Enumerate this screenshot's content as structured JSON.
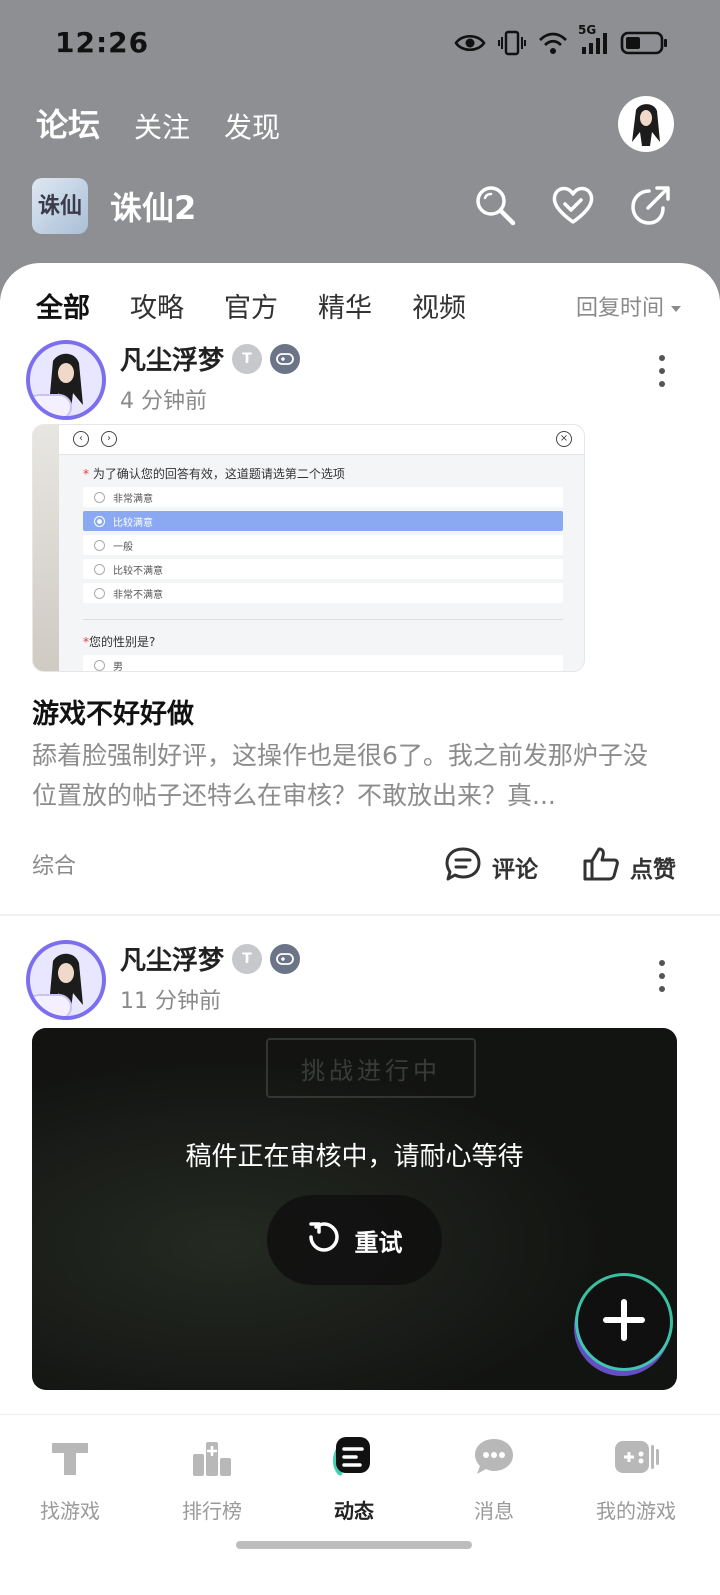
{
  "status_bar": {
    "time": "12:26",
    "network": "5G"
  },
  "header": {
    "tabs": [
      {
        "label": "论坛",
        "active": true
      },
      {
        "label": "关注",
        "active": false
      },
      {
        "label": "发现",
        "active": false
      }
    ]
  },
  "game": {
    "logo_text": "诛仙",
    "name": "诛仙2"
  },
  "filter": {
    "tabs": [
      {
        "label": "全部",
        "active": true
      },
      {
        "label": "攻略",
        "active": false
      },
      {
        "label": "官方",
        "active": false
      },
      {
        "label": "精华",
        "active": false
      },
      {
        "label": "视频",
        "active": false
      }
    ],
    "sort_label": "回复时间"
  },
  "posts": [
    {
      "username": "凡尘浮梦",
      "badge_level": "T",
      "time": "4 分钟前",
      "image": {
        "question1": "为了确认您的回答有效，这道题请选第二个选项",
        "options": [
          "非常满意",
          "比较满意",
          "一般",
          "比较不满意",
          "非常不满意"
        ],
        "selected_index": 1,
        "question2": "您的性别是?",
        "option2": "男"
      },
      "title": "游戏不好好做",
      "body": "舔着脸强制好评，这操作也是很6了。我之前发那炉子没位置放的帖子还特么在审核？不敢放出来？真...",
      "category": "综合",
      "comment_label": "评论",
      "like_label": "点赞"
    },
    {
      "username": "凡尘浮梦",
      "badge_level": "T",
      "time": "11 分钟前",
      "video": {
        "banner_text": "挑战进行中",
        "status": "稿件正在审核中，请耐心等待",
        "retry_label": "重试"
      }
    }
  ],
  "bottom_nav": [
    {
      "label": "找游戏",
      "icon": "find-game-icon",
      "active": false
    },
    {
      "label": "排行榜",
      "icon": "ranking-icon",
      "active": false
    },
    {
      "label": "动态",
      "icon": "feed-icon",
      "active": true
    },
    {
      "label": "消息",
      "icon": "message-icon",
      "active": false
    },
    {
      "label": "我的游戏",
      "icon": "my-games-icon",
      "active": false
    }
  ],
  "colors": {
    "accent": "#3fd1b0",
    "header_bg": "#8e8f93",
    "purple": "#7b6ff0"
  }
}
